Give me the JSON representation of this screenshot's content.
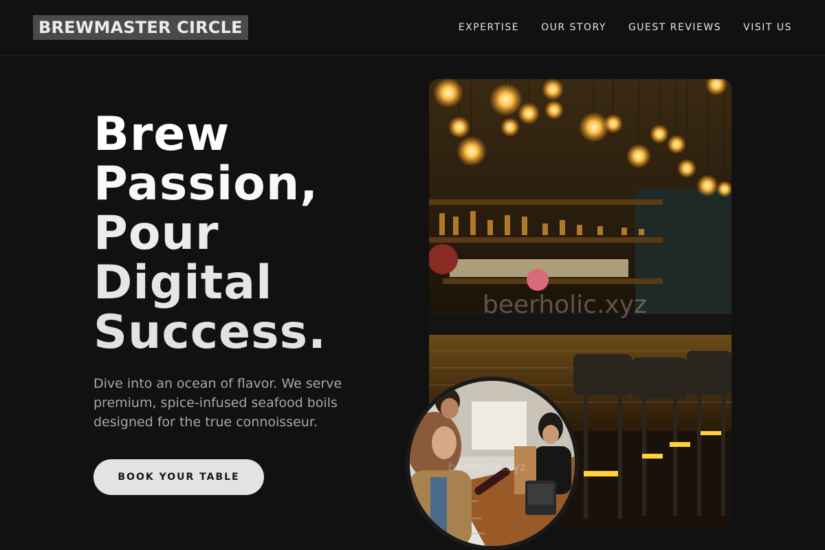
{
  "nav": {
    "logo": "BREWMASTER CIRCLE",
    "links": [
      "EXPERTISE",
      "OUR STORY",
      "GUEST REVIEWS",
      "VISIT US"
    ]
  },
  "hero": {
    "title_lines": [
      "Brew",
      "Passion,",
      "Pour",
      "Digital",
      "Success."
    ],
    "subtitle": "Dive into an ocean of flavor. We serve premium, spice-infused seafood boils designed for the true connoisseur.",
    "cta_label": "BOOK YOUR TABLE"
  },
  "images": {
    "main_watermark": "beerholic.xyz",
    "inset_watermark": "beerholic.xyz"
  },
  "colors": {
    "background": "#111111",
    "logo_bg": "#4a4a4a",
    "cta_bg": "#e3e3e3",
    "subtitle": "#a8a8a8"
  }
}
